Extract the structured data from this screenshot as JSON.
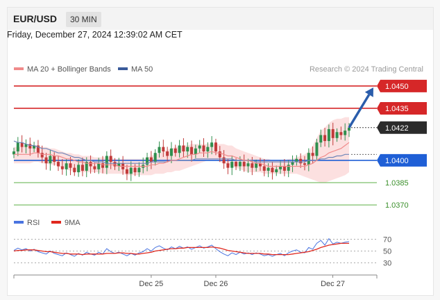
{
  "header": {
    "symbol": "EUR/USD",
    "timeframe": "30 MIN",
    "datetime": "Friday, December 27, 2024 12:39:02 AM CET"
  },
  "colors": {
    "resistance": "#d62728",
    "support": "#1f5fd6",
    "target_green": "#7cbf6a",
    "green_text": "#3a8f2a",
    "ma20": "#f08a8a",
    "ma50": "#6f86b8",
    "band_fill": "#fbd6d6",
    "candle_up": "#2f8f4e",
    "candle_down": "#c13a3a",
    "rsi": "#4a74e0",
    "rsi_ma": "#e0281e",
    "arrow": "#2a5dab",
    "current_price_bg": "#2b2b2b"
  },
  "chart_data": [
    {
      "type": "candlestick",
      "legend": [
        {
          "name": "MA 20 + Bollinger Bands",
          "color": "#f08a8a"
        },
        {
          "name": "MA 50",
          "color": "#3a5a9a"
        }
      ],
      "copyright": "Research © 2024 Trading Central",
      "ylim": [
        1.0364,
        1.0456
      ],
      "x_ticks": [
        {
          "label": "Dec 25",
          "index": 34
        },
        {
          "label": "Dec 26",
          "index": 50
        },
        {
          "label": "Dec 27",
          "index": 80
        }
      ],
      "levels": [
        {
          "value": 1.045,
          "label": "1.0450",
          "kind": "resistance",
          "style": "solid"
        },
        {
          "value": 1.0435,
          "label": "1.0435",
          "kind": "resistance",
          "style": "solid"
        },
        {
          "value": 1.0422,
          "label": "1.0422",
          "kind": "current",
          "style": "dotted"
        },
        {
          "value": 1.04,
          "label": "1.0400",
          "kind": "support",
          "style": "solid"
        },
        {
          "value": 1.0385,
          "label": "1.0385",
          "kind": "target",
          "style": "solid"
        },
        {
          "value": 1.037,
          "label": "1.0370",
          "kind": "target",
          "style": "solid"
        }
      ],
      "forecast_arrow": {
        "from_index": 83,
        "from_value": 1.0422,
        "to_index": 90,
        "to_value": 1.0449
      },
      "close": [
        1.0406,
        1.0412,
        1.0409,
        1.0411,
        1.0408,
        1.041,
        1.0405,
        1.0402,
        1.0398,
        1.0403,
        1.0399,
        1.0396,
        1.0394,
        1.0398,
        1.0395,
        1.0392,
        1.0397,
        1.0393,
        1.0399,
        1.0396,
        1.0394,
        1.0398,
        1.0395,
        1.0403,
        1.0399,
        1.0396,
        1.0398,
        1.0394,
        1.0391,
        1.0395,
        1.0392,
        1.0395,
        1.0397,
        1.0402,
        1.0399,
        1.0405,
        1.0409,
        1.0406,
        1.0403,
        1.0408,
        1.0405,
        1.041,
        1.0406,
        1.0409,
        1.0404,
        1.0408,
        1.041,
        1.0406,
        1.0409,
        1.0412,
        1.0406,
        1.0402,
        1.0398,
        1.0395,
        1.0399,
        1.0396,
        1.0399,
        1.0396,
        1.0398,
        1.0395,
        1.0398,
        1.0396,
        1.0393,
        1.0395,
        1.0392,
        1.0394,
        1.0396,
        1.0393,
        1.0397,
        1.0399,
        1.0401,
        1.0398,
        1.0397,
        1.0405,
        1.0403,
        1.0412,
        1.0417,
        1.0413,
        1.0421,
        1.0415,
        1.0419,
        1.0417,
        1.042,
        1.0422
      ],
      "ma20": [
        1.0404,
        1.0404,
        1.0404,
        1.0404,
        1.0404,
        1.0405,
        1.0405,
        1.0404,
        1.0404,
        1.0404,
        1.0403,
        1.0403,
        1.0402,
        1.0401,
        1.0401,
        1.04,
        1.0399,
        1.0399,
        1.0398,
        1.0398,
        1.0398,
        1.0398,
        1.0397,
        1.0397,
        1.0397,
        1.0397,
        1.0396,
        1.0396,
        1.0396,
        1.0396,
        1.0396,
        1.0396,
        1.0396,
        1.0396,
        1.0397,
        1.0397,
        1.0398,
        1.0398,
        1.0399,
        1.04,
        1.04,
        1.0401,
        1.0402,
        1.0403,
        1.0404,
        1.0404,
        1.0405,
        1.0405,
        1.0405,
        1.0406,
        1.0405,
        1.0405,
        1.0404,
        1.0403,
        1.0403,
        1.0402,
        1.0401,
        1.04,
        1.04,
        1.0399,
        1.0398,
        1.0398,
        1.0397,
        1.0396,
        1.0396,
        1.0396,
        1.0396,
        1.0396,
        1.0396,
        1.0396,
        1.0396,
        1.0396,
        1.0396,
        1.0397,
        1.0398,
        1.04,
        1.0402,
        1.0403,
        1.0405,
        1.0406,
        1.0407,
        1.0408,
        1.041,
        1.0412
      ],
      "upper_band": [
        1.0409,
        1.0409,
        1.0409,
        1.041,
        1.041,
        1.041,
        1.041,
        1.0409,
        1.0409,
        1.0408,
        1.0408,
        1.0407,
        1.0406,
        1.0405,
        1.0405,
        1.0404,
        1.0404,
        1.0403,
        1.0403,
        1.0403,
        1.0402,
        1.0402,
        1.0402,
        1.0402,
        1.0402,
        1.0401,
        1.0401,
        1.0401,
        1.0401,
        1.0401,
        1.0401,
        1.0401,
        1.0401,
        1.0402,
        1.0403,
        1.0404,
        1.0405,
        1.0406,
        1.0407,
        1.0408,
        1.0409,
        1.0409,
        1.041,
        1.041,
        1.0411,
        1.0411,
        1.0411,
        1.0411,
        1.0411,
        1.0411,
        1.0411,
        1.0411,
        1.0411,
        1.041,
        1.041,
        1.0408,
        1.0407,
        1.0406,
        1.0405,
        1.0404,
        1.0403,
        1.0402,
        1.0401,
        1.0401,
        1.04,
        1.04,
        1.04,
        1.04,
        1.0401,
        1.0401,
        1.0402,
        1.0403,
        1.0404,
        1.0406,
        1.041,
        1.0415,
        1.042,
        1.0422,
        1.0425,
        1.0427,
        1.0428,
        1.0428,
        1.0429,
        1.0429
      ],
      "lower_band": [
        1.0398,
        1.0398,
        1.0398,
        1.0398,
        1.0398,
        1.0399,
        1.0399,
        1.0398,
        1.0398,
        1.0397,
        1.0397,
        1.0396,
        1.0395,
        1.0394,
        1.0393,
        1.0393,
        1.0392,
        1.0392,
        1.0392,
        1.0392,
        1.0392,
        1.0392,
        1.0391,
        1.0391,
        1.0391,
        1.0391,
        1.0391,
        1.0391,
        1.039,
        1.039,
        1.039,
        1.039,
        1.039,
        1.039,
        1.039,
        1.0391,
        1.0391,
        1.0391,
        1.0392,
        1.0392,
        1.0393,
        1.0393,
        1.0394,
        1.0395,
        1.0396,
        1.0397,
        1.0398,
        1.0399,
        1.04,
        1.04,
        1.04,
        1.0399,
        1.0398,
        1.0397,
        1.0396,
        1.0395,
        1.0394,
        1.0393,
        1.0392,
        1.0392,
        1.0392,
        1.0392,
        1.0391,
        1.0391,
        1.0391,
        1.0391,
        1.0391,
        1.0391,
        1.0391,
        1.0391,
        1.0391,
        1.039,
        1.0389,
        1.0388,
        1.0387,
        1.0386,
        1.0385,
        1.0385,
        1.0386,
        1.0387,
        1.0388,
        1.0389,
        1.039,
        1.0392
      ],
      "ma50": [
        1.0413,
        1.0412,
        1.0412,
        1.0411,
        1.041,
        1.041,
        1.0409,
        1.0408,
        1.0408,
        1.0407,
        1.0406,
        1.0405,
        1.0405,
        1.0404,
        1.0403,
        1.0402,
        1.0402,
        1.0401,
        1.04,
        1.04,
        1.0399,
        1.0399,
        1.0399,
        1.0398,
        1.0398,
        1.0398,
        1.0398,
        1.0398,
        1.0398,
        1.0398,
        1.0398,
        1.0398,
        1.0398,
        1.0398,
        1.0399,
        1.0399,
        1.0399,
        1.0399,
        1.0399,
        1.04,
        1.04,
        1.04,
        1.04,
        1.04,
        1.04,
        1.0401,
        1.0401,
        1.0401,
        1.0401,
        1.0401,
        1.0401,
        1.0401,
        1.0401,
        1.0401,
        1.0401,
        1.04,
        1.04,
        1.04,
        1.04,
        1.04,
        1.0399,
        1.0399,
        1.0399,
        1.0399,
        1.0399,
        1.0399,
        1.0399,
        1.0399,
        1.0399,
        1.0399,
        1.0399,
        1.0399,
        1.0399,
        1.04,
        1.04,
        1.04,
        1.0401,
        1.0401,
        1.0402,
        1.0402,
        1.0403,
        1.0403,
        1.0404,
        1.0404
      ]
    },
    {
      "type": "line",
      "legend": [
        {
          "name": "RSI",
          "color": "#4a74e0"
        },
        {
          "name": "9MA",
          "color": "#e0281e"
        }
      ],
      "ylim": [
        20,
        80
      ],
      "y_ticks": [
        {
          "label": "70",
          "value": 70
        },
        {
          "label": "50",
          "value": 50
        },
        {
          "label": "30",
          "value": 30
        }
      ],
      "series": [
        {
          "name": "RSI",
          "values": [
            51,
            55,
            52,
            54,
            50,
            53,
            49,
            47,
            45,
            50,
            46,
            44,
            42,
            47,
            44,
            41,
            46,
            43,
            48,
            45,
            43,
            48,
            45,
            54,
            49,
            46,
            48,
            45,
            42,
            46,
            43,
            47,
            49,
            54,
            50,
            56,
            59,
            55,
            52,
            57,
            54,
            58,
            55,
            57,
            53,
            56,
            59,
            55,
            57,
            60,
            54,
            49,
            45,
            42,
            47,
            44,
            48,
            45,
            47,
            44,
            47,
            45,
            42,
            44,
            41,
            44,
            46,
            42,
            47,
            50,
            52,
            48,
            47,
            56,
            53,
            63,
            68,
            60,
            71,
            62,
            65,
            63,
            65,
            66
          ]
        },
        {
          "name": "9MA",
          "values": [
            50,
            51,
            51,
            52,
            52,
            52,
            51,
            50,
            49,
            49,
            48,
            47,
            46,
            46,
            45,
            45,
            45,
            44,
            45,
            45,
            45,
            45,
            45,
            46,
            46,
            46,
            47,
            47,
            46,
            46,
            45,
            45,
            46,
            47,
            48,
            50,
            51,
            52,
            53,
            54,
            54,
            55,
            55,
            56,
            56,
            56,
            56,
            56,
            56,
            57,
            56,
            55,
            53,
            51,
            50,
            49,
            48,
            47,
            46,
            46,
            46,
            46,
            45,
            45,
            44,
            44,
            44,
            44,
            44,
            45,
            46,
            47,
            48,
            49,
            51,
            53,
            56,
            58,
            60,
            61,
            62,
            63,
            63,
            63
          ]
        }
      ]
    }
  ]
}
